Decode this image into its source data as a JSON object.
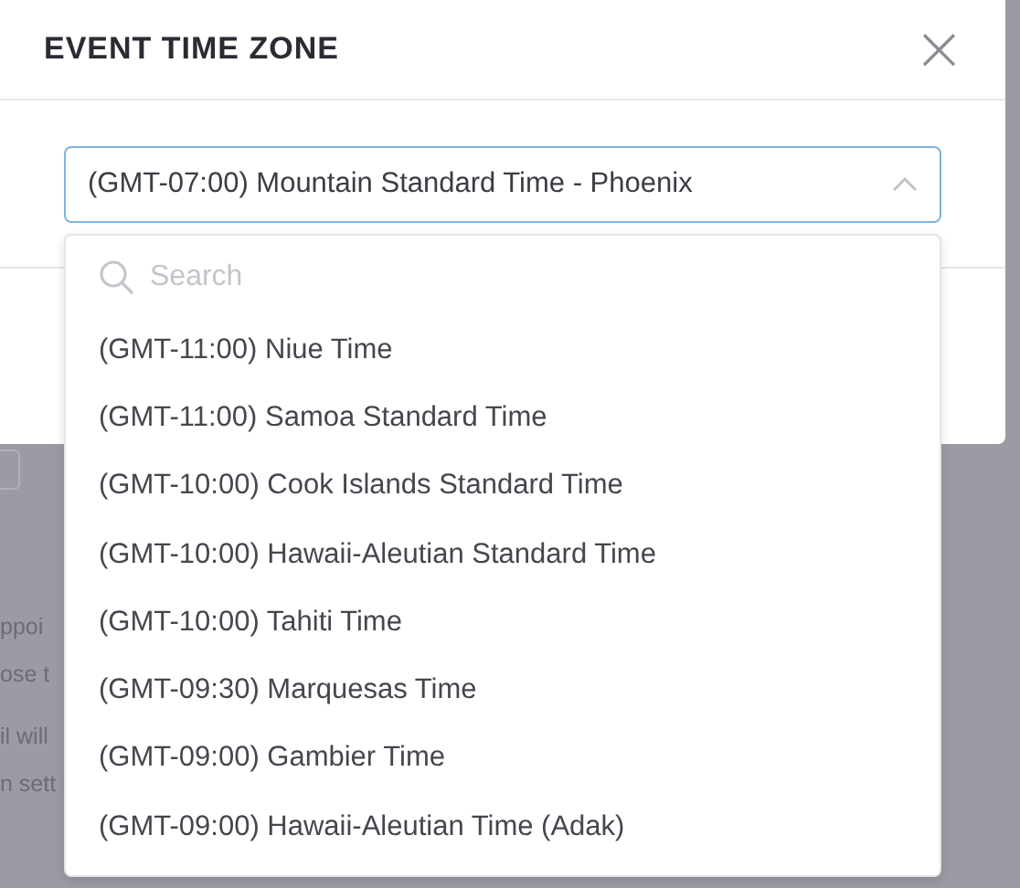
{
  "dialog": {
    "title": "EVENT TIME ZONE",
    "close": "×"
  },
  "time_zone_select": {
    "value": "(GMT-07:00) Mountain Standard Time - Phoenix",
    "expanded": true
  },
  "dropdown": {
    "search": {
      "placeholder": "Search"
    },
    "options": [
      {
        "label": "(GMT-11:00) Niue Time",
        "selected": false
      },
      {
        "label": "(GMT-11:00) Samoa Standard Time",
        "selected": false
      },
      {
        "label": "(GMT-10:00) Cook Islands Standard Time",
        "selected": false
      },
      {
        "label": "(GMT-10:00) Hawaii-Aleutian Standard Time",
        "selected": false
      },
      {
        "label": "(GMT-10:00) Tahiti Time",
        "selected": false
      },
      {
        "label": "(GMT-09:30) Marquesas Time",
        "selected": false
      },
      {
        "label": "(GMT-09:00) Gambier Time",
        "selected": false
      },
      {
        "label": "(GMT-09:00) Hawaii-Aleutian Time (Adak)",
        "selected": false
      }
    ]
  },
  "background_text": [
    "ppoi",
    "ose t",
    "il will",
    "n sett"
  ]
}
